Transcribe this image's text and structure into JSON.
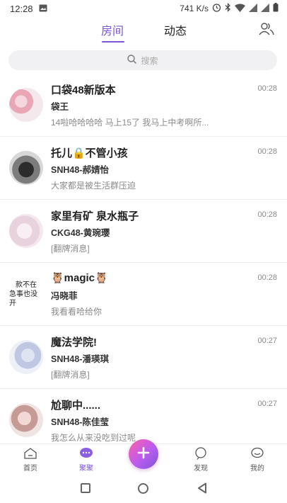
{
  "status_bar": {
    "time": "12:28",
    "speed": "741 K/s"
  },
  "header": {
    "tabs": [
      {
        "label": "房间",
        "active": true
      },
      {
        "label": "动态",
        "active": false
      }
    ]
  },
  "search": {
    "placeholder": "搜索"
  },
  "conversations": [
    {
      "title": "口袋48新版本",
      "subtitle": "袋王",
      "preview": "14啦哈哈哈哈 马上15了 我马上中考啊所...",
      "time": "00:28"
    },
    {
      "title": "托儿🔒不管小孩",
      "subtitle": "SNH48-郝婧怡",
      "preview": "大家都是被生活群压迫",
      "time": "00:28"
    },
    {
      "title": "家里有矿 泉水瓶子",
      "subtitle": "CKG48-黄琬璎",
      "preview": "[翻牌消息]",
      "time": "00:28"
    },
    {
      "title": "🦉magic🦉",
      "subtitle": "冯晓菲",
      "preview": "我看看哈给你",
      "time": "00:28",
      "avatar_text": [
        "款不在",
        "急事也没开"
      ]
    },
    {
      "title": "魔法学院!",
      "subtitle": "SNH48-潘瑛琪",
      "preview": "[翻牌消息]",
      "time": "00:27"
    },
    {
      "title": "尬聊中......",
      "subtitle": "SNH48-陈佳莹",
      "preview": "我怎么从来没吃到过呢",
      "time": "00:27"
    }
  ],
  "bottom_nav": {
    "home": "首页",
    "together": "聚聚",
    "discover": "发现",
    "mine": "我的"
  },
  "colors": {
    "accent": "#7b55d6",
    "fab_gradient_start": "#ff5ea8",
    "fab_gradient_end": "#7b55d6"
  }
}
